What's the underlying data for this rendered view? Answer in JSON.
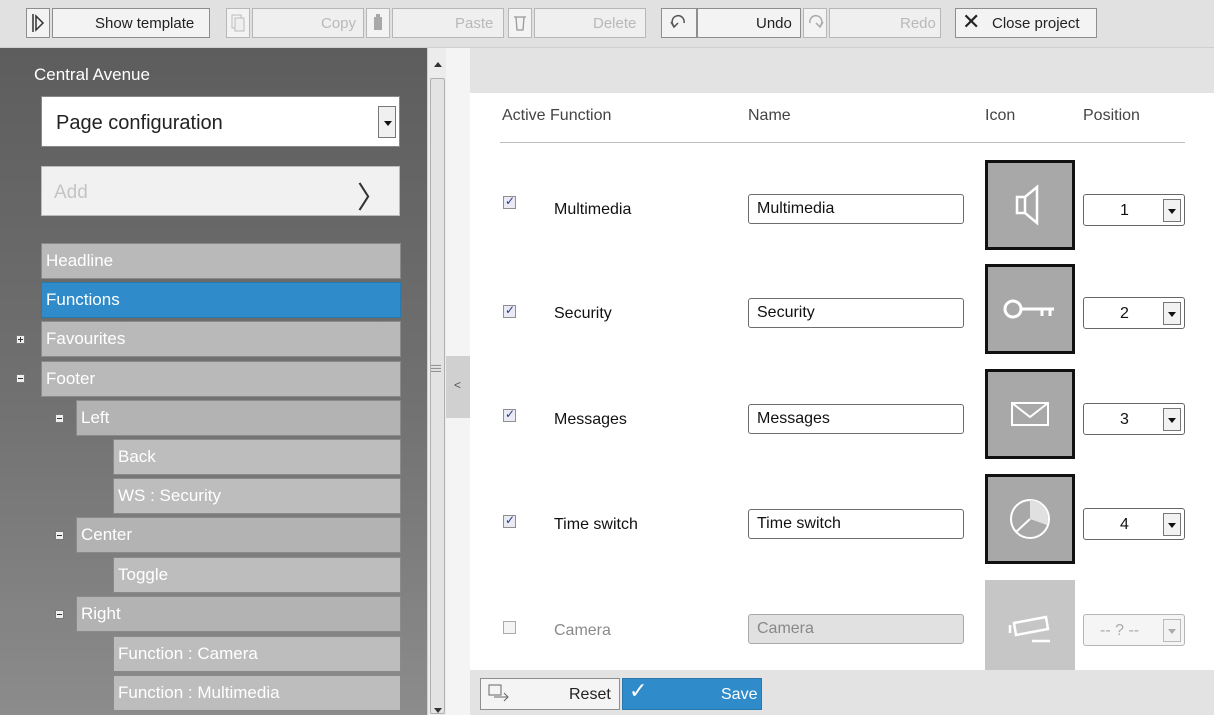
{
  "toolbar": {
    "show_template": "Show template",
    "copy": "Copy",
    "paste": "Paste",
    "delete": "Delete",
    "undo": "Undo",
    "redo": "Redo",
    "close_project": "Close project"
  },
  "sidebar": {
    "project_title": "Central Avenue",
    "dropdown_value": "Page configuration",
    "add_label": "Add",
    "tree": [
      {
        "label": "Headline"
      },
      {
        "label": "Functions",
        "selected": true
      },
      {
        "label": "Favourites"
      },
      {
        "label": "Footer"
      },
      {
        "label": "Left"
      },
      {
        "label": "Back"
      },
      {
        "label": "WS : Security"
      },
      {
        "label": "Center"
      },
      {
        "label": "Toggle"
      },
      {
        "label": "Right"
      },
      {
        "label": "Function : Camera"
      },
      {
        "label": "Function : Multimedia"
      }
    ]
  },
  "main": {
    "columns": {
      "active_function": "Active Function",
      "name": "Name",
      "icon": "Icon",
      "position": "Position"
    },
    "rows": [
      {
        "function": "Multimedia",
        "name": "Multimedia",
        "position": "1",
        "active": true,
        "icon": "speaker-icon"
      },
      {
        "function": "Security",
        "name": "Security",
        "position": "2",
        "active": true,
        "icon": "key-icon"
      },
      {
        "function": "Messages",
        "name": "Messages",
        "position": "3",
        "active": true,
        "icon": "envelope-icon"
      },
      {
        "function": "Time switch",
        "name": "Time switch",
        "position": "4",
        "active": true,
        "icon": "clock-icon"
      },
      {
        "function": "Camera",
        "name": "Camera",
        "position": "-- ? --",
        "active": false,
        "icon": "camera-icon"
      }
    ],
    "reset": "Reset",
    "save": "Save"
  },
  "colors": {
    "accent": "#2f8bc9",
    "sidebar_bg": "#6a6a6a"
  }
}
